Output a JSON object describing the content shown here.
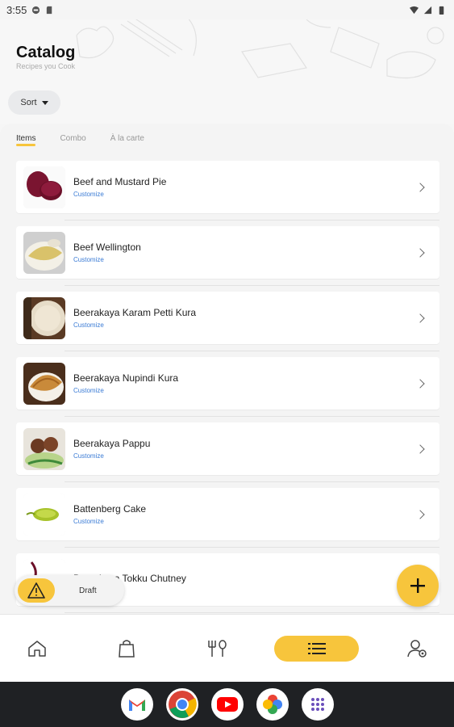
{
  "status_bar": {
    "time": "3:55"
  },
  "header": {
    "title": "Catalog",
    "subtitle": "Recipes you Cook"
  },
  "sort": {
    "label": "Sort"
  },
  "tabs": [
    {
      "label": "Items",
      "active": true
    },
    {
      "label": "Combo",
      "active": false
    },
    {
      "label": "À la carte",
      "active": false
    }
  ],
  "items": [
    {
      "name": "Beef and Mustard Pie",
      "sub": "Customize",
      "icon": "beet-slices"
    },
    {
      "name": "Beef Wellington",
      "sub": "Customize",
      "icon": "dosa-plate"
    },
    {
      "name": "Beerakaya Karam Petti Kura",
      "sub": "Customize",
      "icon": "flatbread"
    },
    {
      "name": "Beerakaya Nupindi Kura",
      "sub": "Customize",
      "icon": "dosa-plate"
    },
    {
      "name": "Beerakaya Pappu",
      "sub": "Customize",
      "icon": "kebab-plate"
    },
    {
      "name": "Battenberg Cake",
      "sub": "Customize",
      "icon": "green-vegetable"
    },
    {
      "name": "Beerakaya Tokku Chutney",
      "sub": "",
      "icon": "beet"
    }
  ],
  "draft": {
    "label": "Draft"
  },
  "bottom_nav": {
    "items": [
      "home-icon",
      "bag-icon",
      "dine-icon",
      "catalog-icon",
      "profile-settings-icon"
    ],
    "active": "catalog-icon"
  },
  "dock": [
    "gmail-icon",
    "chrome-icon",
    "youtube-icon",
    "photos-icon",
    "apps-icon"
  ],
  "colors": {
    "accent": "#f7c53c",
    "link": "#3a7bd5",
    "system_bar": "#1f2124"
  }
}
